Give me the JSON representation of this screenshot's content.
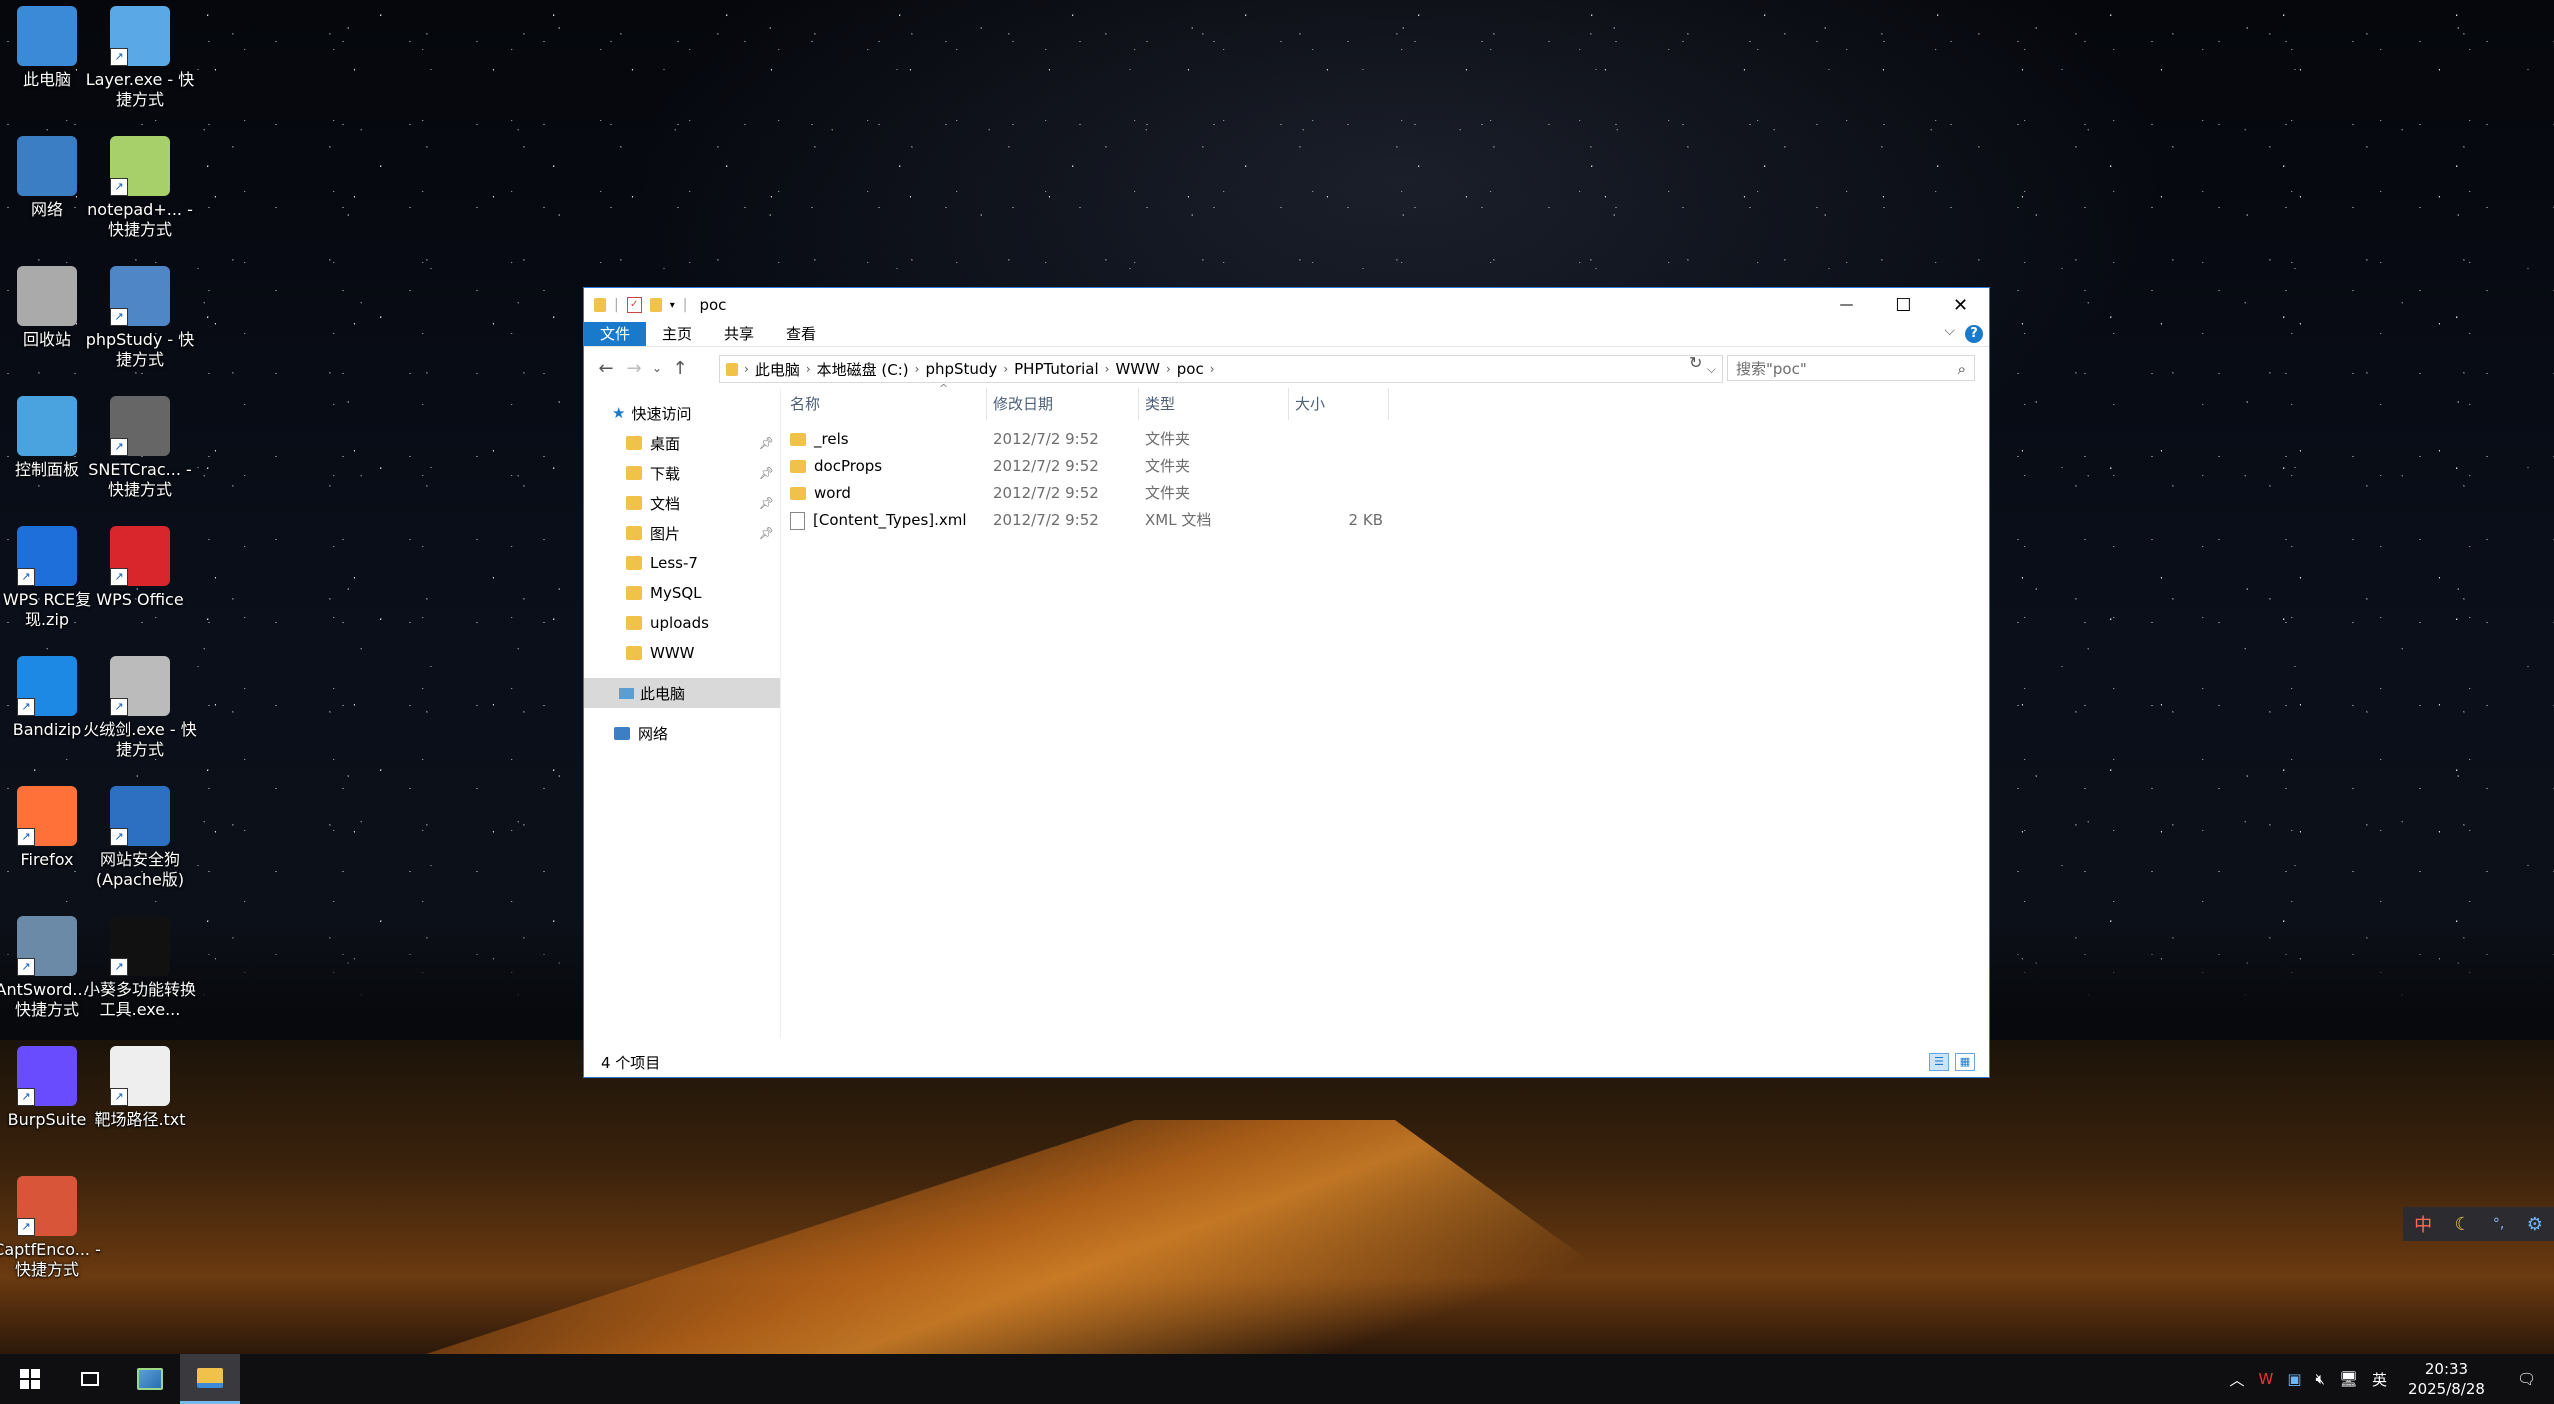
{
  "desktop": {
    "icons": [
      {
        "label": "此电脑",
        "icon": "this-pc-icon"
      },
      {
        "label": "Layer.exe - 快捷方式",
        "icon": "layer-icon"
      },
      {
        "label": "网络",
        "icon": "network-icon"
      },
      {
        "label": "notepad+... - 快捷方式",
        "icon": "notepad-icon"
      },
      {
        "label": "回收站",
        "icon": "recycle-bin-icon"
      },
      {
        "label": "phpStudy - 快捷方式",
        "icon": "phpstudy-icon"
      },
      {
        "label": "控制面板",
        "icon": "control-panel-icon"
      },
      {
        "label": "SNETCrac... - 快捷方式",
        "icon": "snetcrack-icon"
      },
      {
        "label": "WPS RCE复现.zip",
        "icon": "zip-icon"
      },
      {
        "label": "WPS Office",
        "icon": "wps-icon"
      },
      {
        "label": "Bandizip",
        "icon": "bandizip-icon"
      },
      {
        "label": "火绒剑.exe - 快捷方式",
        "icon": "huorong-icon"
      },
      {
        "label": "Firefox",
        "icon": "firefox-icon"
      },
      {
        "label": "网站安全狗(Apache版)",
        "icon": "safedog-icon"
      },
      {
        "label": "AntSword... - 快捷方式",
        "icon": "antsword-icon"
      },
      {
        "label": "小葵多功能转换工具.exe...",
        "icon": "xiaokui-icon"
      },
      {
        "label": "BurpSuite",
        "icon": "burpsuite-icon"
      },
      {
        "label": "靶场路径.txt",
        "icon": "txt-file-icon"
      },
      {
        "label": "CaptfEnco... - 快捷方式",
        "icon": "captfencoder-icon"
      }
    ]
  },
  "explorer": {
    "title": "poc",
    "window_buttons": {
      "minimize": "—",
      "maximize": "☐",
      "close": "✕"
    },
    "ribbon_tabs": [
      "文件",
      "主页",
      "共享",
      "查看"
    ],
    "help": "?",
    "address": {
      "segments": [
        "此电脑",
        "本地磁盘 (C:)",
        "phpStudy",
        "PHPTutorial",
        "WWW",
        "poc"
      ]
    },
    "search_placeholder": "搜索\"poc\"",
    "nav": {
      "quick_access": "快速访问",
      "items": [
        {
          "label": "桌面",
          "pinned": true
        },
        {
          "label": "下载",
          "pinned": true
        },
        {
          "label": "文档",
          "pinned": true
        },
        {
          "label": "图片",
          "pinned": true
        },
        {
          "label": "Less-7",
          "pinned": false
        },
        {
          "label": "MySQL",
          "pinned": false
        },
        {
          "label": "uploads",
          "pinned": false
        },
        {
          "label": "WWW",
          "pinned": false
        }
      ],
      "this_pc": "此电脑",
      "network": "网络"
    },
    "columns": [
      "名称",
      "修改日期",
      "类型",
      "大小"
    ],
    "files": [
      {
        "name": "_rels",
        "date": "2012/7/2 9:52",
        "type": "文件夹",
        "size": "",
        "kind": "folder"
      },
      {
        "name": "docProps",
        "date": "2012/7/2 9:52",
        "type": "文件夹",
        "size": "",
        "kind": "folder"
      },
      {
        "name": "word",
        "date": "2012/7/2 9:52",
        "type": "文件夹",
        "size": "",
        "kind": "folder"
      },
      {
        "name": "[Content_Types].xml",
        "date": "2012/7/2 9:52",
        "type": "XML 文档",
        "size": "2 KB",
        "kind": "xml"
      }
    ],
    "status": "4 个项目"
  },
  "ime": {
    "lang": "中",
    "moon": "☾",
    "punct": "°,",
    "gear": "⚙"
  },
  "taskbar": {
    "tray_lang": "英",
    "time": "20:33",
    "date": "2025/8/28"
  },
  "colors": {
    "accent": "#1979ca",
    "folder": "#f1c24a"
  }
}
